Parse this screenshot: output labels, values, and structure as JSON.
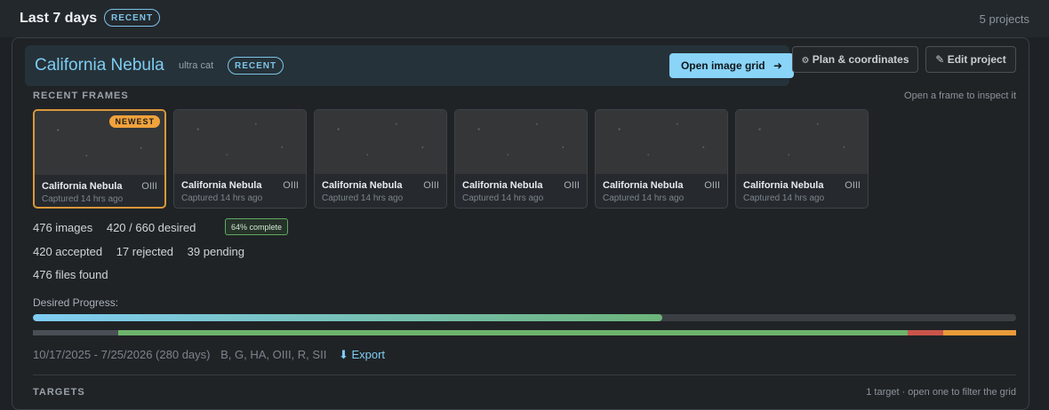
{
  "section": {
    "title": "Last 7 days",
    "badge": "RECENT",
    "count": "5 projects"
  },
  "project": {
    "name": "California Nebula",
    "camera": "ultra cat",
    "badge": "RECENT",
    "open_grid_label": "Open image grid",
    "plan_label": "Plan & coordinates",
    "edit_label": "Edit project"
  },
  "recent_frames": {
    "heading": "RECENT FRAMES",
    "hint": "Open a frame to inspect it",
    "newest_label": "NEWEST",
    "items": [
      {
        "name": "California Nebula",
        "filter": "OIII",
        "time": "Captured 14 hrs ago"
      },
      {
        "name": "California Nebula",
        "filter": "OIII",
        "time": "Captured 14 hrs ago"
      },
      {
        "name": "California Nebula",
        "filter": "OIII",
        "time": "Captured 14 hrs ago"
      },
      {
        "name": "California Nebula",
        "filter": "OIII",
        "time": "Captured 14 hrs ago"
      },
      {
        "name": "California Nebula",
        "filter": "OIII",
        "time": "Captured 14 hrs ago"
      },
      {
        "name": "California Nebula",
        "filter": "OIII",
        "time": "Captured 14 hrs ago"
      }
    ]
  },
  "stats": {
    "images": "476 images",
    "desired": "420 / 660 desired",
    "complete_badge": "64% complete",
    "accepted": "420 accepted",
    "rejected": "17 rejected",
    "pending": "39 pending",
    "files_found": "476 files found"
  },
  "progress": {
    "label": "Desired Progress:",
    "desired_fraction": 0.64,
    "status_fractions": {
      "other": 0.087,
      "accepted": 0.803,
      "rejected": 0.036,
      "pending": 0.074
    }
  },
  "footer": {
    "date_range": "10/17/2025 - 7/25/2026 (280 days)",
    "filters": "B, G, HA, OIII, R, SII",
    "export_label": "Export"
  },
  "targets": {
    "heading": "TARGETS",
    "hint": "1 target · open one to filter the grid"
  },
  "colors": {
    "accent": "#7dcdf3",
    "accepted": "#6db46b",
    "rejected": "#c9554a",
    "pending": "#e89b3a",
    "newest": "#f0a23c"
  }
}
